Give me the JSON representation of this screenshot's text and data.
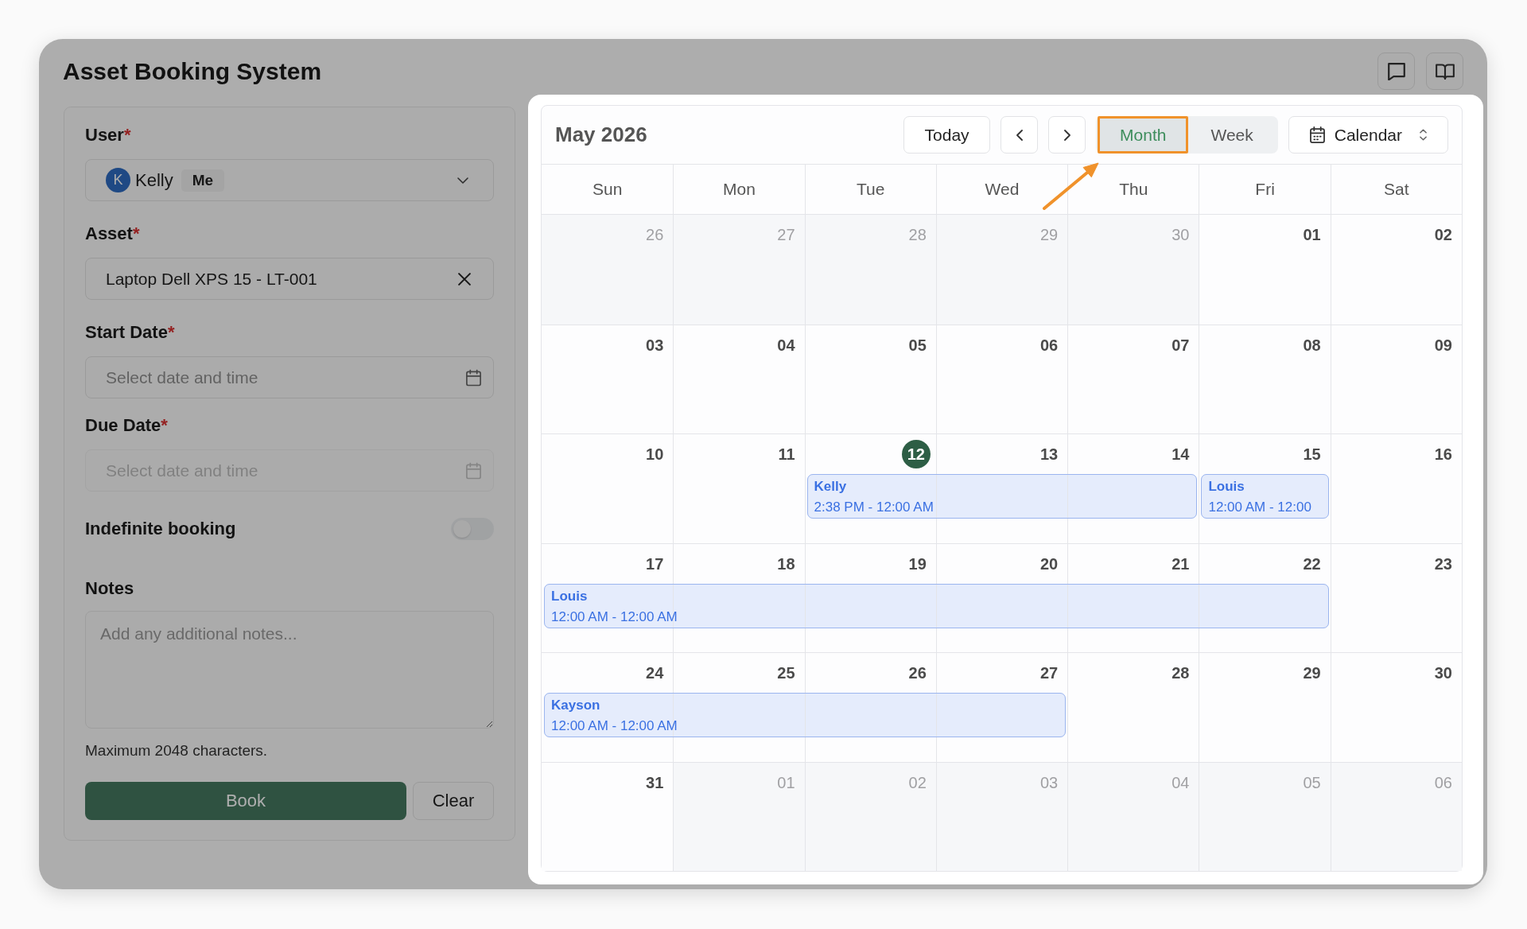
{
  "window": {
    "title": "Asset Booking System",
    "dimmed": true
  },
  "booking_form": {
    "fields": [
      {
        "kind": "user",
        "label": "User",
        "required_mark": "*",
        "avatar": "K",
        "value": "Kelly",
        "tag": "Me"
      },
      {
        "kind": "asset",
        "label": "Asset",
        "required_mark": "*",
        "value": "Laptop Dell XPS 15 - LT-001"
      },
      {
        "kind": "datetime",
        "label": "Start Date",
        "required_mark": "*",
        "placeholder": "Select date and time",
        "disabled": false
      },
      {
        "kind": "datetime",
        "label": "Due Date",
        "required_mark": "*",
        "placeholder": "Select date and time",
        "disabled": true
      },
      {
        "kind": "toggle",
        "label": "Indefinite booking",
        "on": false
      },
      {
        "kind": "notes",
        "label": "Notes",
        "placeholder": "Add any additional notes...",
        "hint": "Maximum 2048 characters."
      }
    ],
    "buttons": [
      {
        "kind": "primary",
        "label": "Book"
      },
      {
        "kind": "secondary",
        "label": "Clear"
      }
    ]
  },
  "calendar": {
    "title": "May 2026",
    "today_button": "Today",
    "views": [
      {
        "label": "Month",
        "selected": true,
        "highlighted": true
      },
      {
        "label": "Week",
        "selected": false,
        "highlighted": false
      }
    ],
    "source_select": "Calendar",
    "weekdays": [
      "Sun",
      "Mon",
      "Tue",
      "Wed",
      "Thu",
      "Fri",
      "Sat"
    ],
    "weeks": [
      {
        "days": [
          {
            "label": "26",
            "in_month": false,
            "today": false,
            "booked": false
          },
          {
            "label": "27",
            "in_month": false,
            "today": false,
            "booked": false
          },
          {
            "label": "28",
            "in_month": false,
            "today": false,
            "booked": false
          },
          {
            "label": "29",
            "in_month": false,
            "today": false,
            "booked": false
          },
          {
            "label": "30",
            "in_month": false,
            "today": false,
            "booked": false
          },
          {
            "label": "01",
            "in_month": true,
            "today": false,
            "booked": false
          },
          {
            "label": "02",
            "in_month": true,
            "today": false,
            "booked": false
          }
        ]
      },
      {
        "days": [
          {
            "label": "03",
            "in_month": true,
            "today": false,
            "booked": false
          },
          {
            "label": "04",
            "in_month": true,
            "today": false,
            "booked": false
          },
          {
            "label": "05",
            "in_month": true,
            "today": false,
            "booked": false
          },
          {
            "label": "06",
            "in_month": true,
            "today": false,
            "booked": false
          },
          {
            "label": "07",
            "in_month": true,
            "today": false,
            "booked": false
          },
          {
            "label": "08",
            "in_month": true,
            "today": false,
            "booked": false
          },
          {
            "label": "09",
            "in_month": true,
            "today": false,
            "booked": false
          }
        ]
      },
      {
        "days": [
          {
            "label": "10",
            "in_month": true,
            "today": false,
            "booked": false
          },
          {
            "label": "11",
            "in_month": true,
            "today": false,
            "booked": false
          },
          {
            "label": "12",
            "in_month": true,
            "today": true,
            "booked": true,
            "event": {
              "title": "Kelly",
              "time": "2:38 PM - 12:00 AM"
            }
          },
          {
            "label": "13",
            "in_month": true,
            "today": false,
            "booked": true
          },
          {
            "label": "14",
            "in_month": true,
            "today": false,
            "booked": true
          },
          {
            "label": "15",
            "in_month": true,
            "today": false,
            "booked": true,
            "event": {
              "title": "Louis",
              "time": "12:00 AM - 12:00"
            }
          },
          {
            "label": "16",
            "in_month": true,
            "today": false,
            "booked": false
          }
        ]
      },
      {
        "days": [
          {
            "label": "17",
            "in_month": true,
            "today": false,
            "booked": true,
            "event": {
              "title": "Louis",
              "time": "12:00 AM - 12:00 AM"
            }
          },
          {
            "label": "18",
            "in_month": true,
            "today": false,
            "booked": true
          },
          {
            "label": "19",
            "in_month": true,
            "today": false,
            "booked": true
          },
          {
            "label": "20",
            "in_month": true,
            "today": false,
            "booked": true
          },
          {
            "label": "21",
            "in_month": true,
            "today": false,
            "booked": true
          },
          {
            "label": "22",
            "in_month": true,
            "today": false,
            "booked": true
          },
          {
            "label": "23",
            "in_month": true,
            "today": false,
            "booked": false
          }
        ]
      },
      {
        "days": [
          {
            "label": "24",
            "in_month": true,
            "today": false,
            "booked": true,
            "event": {
              "title": "Kayson",
              "time": "12:00 AM - 12:00 AM"
            }
          },
          {
            "label": "25",
            "in_month": true,
            "today": false,
            "booked": true
          },
          {
            "label": "26",
            "in_month": true,
            "today": false,
            "booked": true
          },
          {
            "label": "27",
            "in_month": true,
            "today": false,
            "booked": true
          },
          {
            "label": "28",
            "in_month": true,
            "today": false,
            "booked": false
          },
          {
            "label": "29",
            "in_month": true,
            "today": false,
            "booked": false
          },
          {
            "label": "30",
            "in_month": true,
            "today": false,
            "booked": false
          }
        ]
      },
      {
        "days": [
          {
            "label": "31",
            "in_month": true,
            "today": false,
            "booked": false
          },
          {
            "label": "01",
            "in_month": false,
            "today": false,
            "booked": false
          },
          {
            "label": "02",
            "in_month": false,
            "today": false,
            "booked": false
          },
          {
            "label": "03",
            "in_month": false,
            "today": false,
            "booked": false
          },
          {
            "label": "04",
            "in_month": false,
            "today": false,
            "booked": false
          },
          {
            "label": "05",
            "in_month": false,
            "today": false,
            "booked": false
          },
          {
            "label": "06",
            "in_month": false,
            "today": false,
            "booked": false
          }
        ]
      }
    ]
  }
}
